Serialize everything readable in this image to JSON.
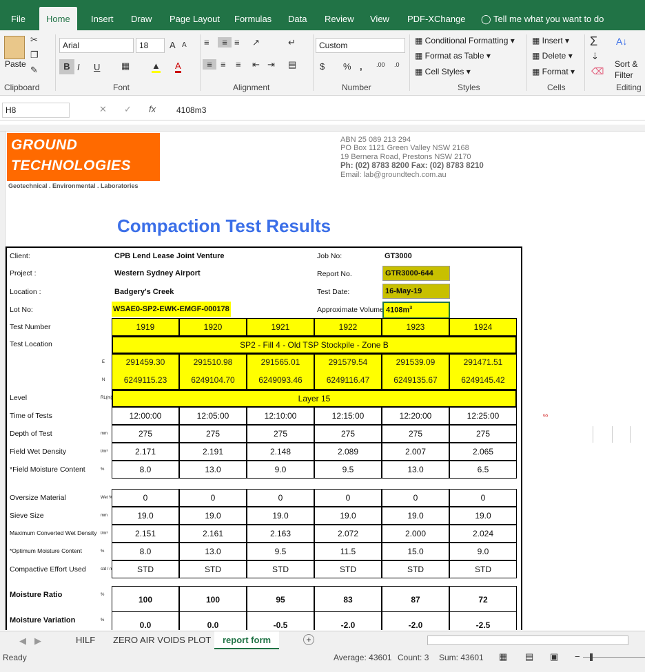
{
  "ribbon_tabs": [
    "File",
    "Home",
    "Insert",
    "Draw",
    "Page Layout",
    "Formulas",
    "Data",
    "Review",
    "View",
    "PDF-XChange",
    "Tell me what you want to do"
  ],
  "ribbon": {
    "paste": "Paste",
    "font_name": "Arial",
    "font_size": "18",
    "number_format": "Custom",
    "conditional": "Conditional Formatting",
    "format_table": "Format as Table",
    "cell_styles": "Cell Styles",
    "insert": "Insert",
    "delete": "Delete",
    "format": "Format",
    "sort": "Sort &",
    "filter": "Filter",
    "groups": [
      "Clipboard",
      "Font",
      "Alignment",
      "Number",
      "Styles",
      "Cells",
      "Editing"
    ]
  },
  "formula_bar": {
    "name_box": "H8",
    "formula": "4108m3"
  },
  "sheet": {
    "company_line1": "GROUND",
    "company_line2": "TECHNOLOGIES",
    "tagline": "Geotechnical . Environmental . Laboratories",
    "abn": "ABN 25 089 213 294",
    "po": "PO Box 1121 Green Valley NSW 2168",
    "road": "19 Bernera Road, Prestons NSW 2170",
    "phone": "Ph: (02) 8783 8200  Fax: (02) 8783 8210",
    "email": "Email: lab@groundtech.com.au",
    "title": "Compaction Test Results",
    "client_lbl": "Client:",
    "client": "CPB Lend Lease Joint Venture",
    "project_lbl": "Project :",
    "project": "Western Sydney Airport",
    "location_lbl": "Location :",
    "location": "Badgery's Creek",
    "lot_lbl": "Lot No:",
    "lot": "WSAE0-SP2-EWK-EMGF-000178",
    "job_lbl": "Job No:",
    "job": "GT3000",
    "report_lbl": "Report No.",
    "report": "GTR3000-644",
    "date_lbl": "Test Date:",
    "date": "16-May-19",
    "volume_lbl": "Approximate Volume",
    "volume": "4108m",
    "test_location": "SP2 - Fill 4 - Old TSP Stockpile - Zone B",
    "level": "Layer 15"
  },
  "rows": [
    {
      "label": "Test Number",
      "unit": "",
      "values": [
        "1919",
        "1920",
        "1921",
        "1922",
        "1923",
        "1924"
      ]
    },
    {
      "label": "Time of Tests",
      "unit": "",
      "values": [
        "12:00:00",
        "12:05:00",
        "12:10:00",
        "12:15:00",
        "12:20:00",
        "12:25:00"
      ]
    },
    {
      "label": "Depth of Test",
      "unit": "mm",
      "values": [
        "275",
        "275",
        "275",
        "275",
        "275",
        "275"
      ]
    },
    {
      "label": "Field Wet Density",
      "unit": "t/m³",
      "values": [
        "2.171",
        "2.191",
        "2.148",
        "2.089",
        "2.007",
        "2.065"
      ]
    },
    {
      "label": "*Field Moisture Content",
      "unit": "%",
      "values": [
        "8.0",
        "13.0",
        "9.0",
        "9.5",
        "13.0",
        "6.5"
      ]
    },
    {
      "label": "Oversize Material",
      "unit": "Wet %",
      "values": [
        "0",
        "0",
        "0",
        "0",
        "0",
        "0"
      ]
    },
    {
      "label": "Sieve Size",
      "unit": "mm",
      "values": [
        "19.0",
        "19.0",
        "19.0",
        "19.0",
        "19.0",
        "19.0"
      ]
    },
    {
      "label": "Maximum Converted Wet Density",
      "unit": "t/m³",
      "values": [
        "2.151",
        "2.161",
        "2.163",
        "2.072",
        "2.000",
        "2.024"
      ]
    },
    {
      "label": "*Optimum Moisture Content",
      "unit": "%",
      "values": [
        "8.0",
        "13.0",
        "9.5",
        "11.5",
        "15.0",
        "9.0"
      ]
    },
    {
      "label": "Compactive Effort Used",
      "unit": "std / mod",
      "values": [
        "STD",
        "STD",
        "STD",
        "STD",
        "STD",
        "STD"
      ]
    },
    {
      "label": "Moisture Ratio",
      "unit": "%",
      "values": [
        "100",
        "100",
        "95",
        "83",
        "87",
        "72"
      ]
    },
    {
      "label": "Moisture Variation",
      "unit": "%",
      "values": [
        "0.0",
        "0.0",
        "-0.5",
        "-2.0",
        "-2.0",
        "-2.5"
      ]
    }
  ],
  "test_location_label": "Test Location",
  "level_label": "Level",
  "level_unit": "RL(m)",
  "easting": [
    "291459.30",
    "291510.98",
    "291565.01",
    "291579.54",
    "291539.09",
    "291471.51"
  ],
  "northing": [
    "6249115.23",
    "6249104.70",
    "6249093.46",
    "6249116.47",
    "6249135.67",
    "6249145.42"
  ],
  "sheet_tabs": [
    "HILF",
    "ZERO AIR VOIDS PLOT",
    "report form"
  ],
  "status": {
    "ready": "Ready",
    "average": "Average: 43601",
    "count": "Count: 3",
    "sum": "Sum: 43601"
  }
}
